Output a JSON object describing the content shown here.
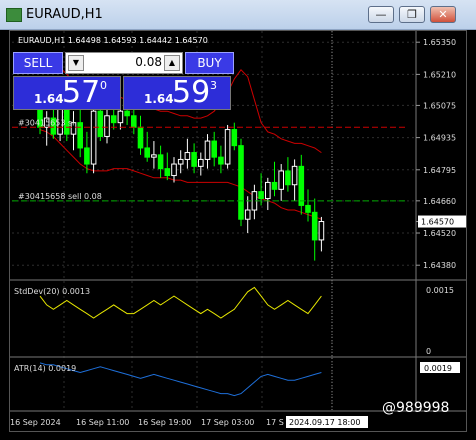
{
  "window": {
    "title": "EURAUD,H1",
    "minimize_glyph": "—",
    "restore_glyph": "❐",
    "close_glyph": "✕"
  },
  "chart_header": "EURAUD,H1  1.64498 1.64593 1.64442 1.64570",
  "trade_panel": {
    "sell_label": "SELL",
    "buy_label": "BUY",
    "lot": "0.08",
    "down_arrow": "▼",
    "up_arrow": "▲",
    "sell_price": {
      "prefix": "1.64",
      "big": "57",
      "sup": "0"
    },
    "buy_price": {
      "prefix": "1.64",
      "big": "59",
      "sup": "3"
    }
  },
  "orders": [
    {
      "label": "#30415653 sl"
    },
    {
      "label": "#30415658 sell 0.08"
    }
  ],
  "price_axis": [
    "1.65350",
    "1.65210",
    "1.65075",
    "1.64935",
    "1.64795",
    "1.64660",
    "1.64570",
    "1.64520",
    "1.64380"
  ],
  "current_price": "1.64570",
  "indicators": {
    "stddev": {
      "label": "StdDev(20) 0.0013",
      "axis_top": "0.0015",
      "axis_bottom": "0"
    },
    "atr": {
      "label": "ATR(14) 0.0019",
      "value": "0.0019"
    }
  },
  "time_axis": [
    "16 Sep 2024",
    "16 Sep 11:00",
    "16 Sep 19:00",
    "17 Sep 03:00",
    "17 S"
  ],
  "time_cursor": "2024.09.17 18:00",
  "watermark": "@989998",
  "colors": {
    "bull": "#ffffff",
    "bear": "#00ff00",
    "grid": "#2e2e2e",
    "band": "#cc0000",
    "stddev": "#e6e600",
    "atr": "#1e6fd9",
    "sl_line": "#cc0000",
    "order_line": "#00aa00"
  },
  "candles": [
    {
      "o": 1.6507,
      "h": 1.6512,
      "l": 1.6495,
      "c": 1.6498
    },
    {
      "o": 1.6498,
      "h": 1.6505,
      "l": 1.649,
      "c": 1.6502
    },
    {
      "o": 1.6502,
      "h": 1.651,
      "l": 1.6493,
      "c": 1.6495
    },
    {
      "o": 1.6495,
      "h": 1.6512,
      "l": 1.6492,
      "c": 1.6508
    },
    {
      "o": 1.6508,
      "h": 1.6511,
      "l": 1.6492,
      "c": 1.6495
    },
    {
      "o": 1.6495,
      "h": 1.6505,
      "l": 1.6488,
      "c": 1.65
    },
    {
      "o": 1.65,
      "h": 1.6506,
      "l": 1.6485,
      "c": 1.6489
    },
    {
      "o": 1.6489,
      "h": 1.6496,
      "l": 1.6478,
      "c": 1.6482
    },
    {
      "o": 1.6482,
      "h": 1.6508,
      "l": 1.6478,
      "c": 1.6505
    },
    {
      "o": 1.6505,
      "h": 1.6509,
      "l": 1.6492,
      "c": 1.6494
    },
    {
      "o": 1.6494,
      "h": 1.6506,
      "l": 1.6491,
      "c": 1.6503
    },
    {
      "o": 1.6503,
      "h": 1.6508,
      "l": 1.6497,
      "c": 1.65
    },
    {
      "o": 1.65,
      "h": 1.6507,
      "l": 1.6497,
      "c": 1.6505
    },
    {
      "o": 1.6505,
      "h": 1.6509,
      "l": 1.6499,
      "c": 1.6503
    },
    {
      "o": 1.6503,
      "h": 1.6508,
      "l": 1.6495,
      "c": 1.6498
    },
    {
      "o": 1.6498,
      "h": 1.6503,
      "l": 1.6486,
      "c": 1.6489
    },
    {
      "o": 1.6489,
      "h": 1.6496,
      "l": 1.6483,
      "c": 1.6485
    },
    {
      "o": 1.6485,
      "h": 1.6492,
      "l": 1.648,
      "c": 1.6486
    },
    {
      "o": 1.6486,
      "h": 1.649,
      "l": 1.6476,
      "c": 1.648
    },
    {
      "o": 1.648,
      "h": 1.6487,
      "l": 1.6475,
      "c": 1.6477
    },
    {
      "o": 1.6477,
      "h": 1.6485,
      "l": 1.6474,
      "c": 1.6482
    },
    {
      "o": 1.6482,
      "h": 1.6488,
      "l": 1.6478,
      "c": 1.6484
    },
    {
      "o": 1.6484,
      "h": 1.6493,
      "l": 1.648,
      "c": 1.6487
    },
    {
      "o": 1.6487,
      "h": 1.6491,
      "l": 1.6478,
      "c": 1.6481
    },
    {
      "o": 1.6481,
      "h": 1.6487,
      "l": 1.6477,
      "c": 1.6484
    },
    {
      "o": 1.6484,
      "h": 1.6495,
      "l": 1.648,
      "c": 1.6492
    },
    {
      "o": 1.6492,
      "h": 1.6496,
      "l": 1.6481,
      "c": 1.6485
    },
    {
      "o": 1.6485,
      "h": 1.649,
      "l": 1.6478,
      "c": 1.6482
    },
    {
      "o": 1.6482,
      "h": 1.6499,
      "l": 1.648,
      "c": 1.6497
    },
    {
      "o": 1.6497,
      "h": 1.65,
      "l": 1.6488,
      "c": 1.649
    },
    {
      "o": 1.649,
      "h": 1.6493,
      "l": 1.6455,
      "c": 1.6458
    },
    {
      "o": 1.6458,
      "h": 1.6468,
      "l": 1.6452,
      "c": 1.6462
    },
    {
      "o": 1.6462,
      "h": 1.6473,
      "l": 1.6458,
      "c": 1.647
    },
    {
      "o": 1.647,
      "h": 1.6478,
      "l": 1.6464,
      "c": 1.6467
    },
    {
      "o": 1.6467,
      "h": 1.6476,
      "l": 1.6462,
      "c": 1.6474
    },
    {
      "o": 1.6474,
      "h": 1.6483,
      "l": 1.6468,
      "c": 1.6471
    },
    {
      "o": 1.6471,
      "h": 1.6482,
      "l": 1.6466,
      "c": 1.6479
    },
    {
      "o": 1.6479,
      "h": 1.6485,
      "l": 1.647,
      "c": 1.6473
    },
    {
      "o": 1.6473,
      "h": 1.6484,
      "l": 1.6466,
      "c": 1.6481
    },
    {
      "o": 1.6481,
      "h": 1.6486,
      "l": 1.646,
      "c": 1.6464
    },
    {
      "o": 1.6464,
      "h": 1.6471,
      "l": 1.6457,
      "c": 1.6461
    },
    {
      "o": 1.6461,
      "h": 1.6467,
      "l": 1.644,
      "c": 1.6449
    },
    {
      "o": 1.6449,
      "h": 1.6459,
      "l": 1.6444,
      "c": 1.6457
    }
  ],
  "upper_band": [
    1.6528,
    1.6527,
    1.6526,
    1.6524,
    1.6521,
    1.6518,
    1.6517,
    1.6516,
    1.6515,
    1.6514,
    1.6513,
    1.6512,
    1.6511,
    1.651,
    1.6509,
    1.6508,
    1.6507,
    1.6506,
    1.6505,
    1.6505,
    1.6504,
    1.6503,
    1.6503,
    1.6502,
    1.6502,
    1.6503,
    1.6505,
    1.6509,
    1.6513,
    1.6519,
    1.6523,
    1.652,
    1.651,
    1.65,
    1.6496,
    1.6495,
    1.6493,
    1.6492,
    1.6491,
    1.6491,
    1.649,
    1.6489,
    1.6487
  ],
  "lower_band": [
    1.6497,
    1.6496,
    1.6494,
    1.6491,
    1.6488,
    1.6485,
    1.6482,
    1.648,
    1.6479,
    1.6479,
    1.6479,
    1.648,
    1.648,
    1.648,
    1.6479,
    1.6478,
    1.6477,
    1.6476,
    1.6476,
    1.6476,
    1.6475,
    1.6475,
    1.6474,
    1.6474,
    1.6474,
    1.6474,
    1.6474,
    1.6474,
    1.6474,
    1.6473,
    1.6472,
    1.647,
    1.6468,
    1.6467,
    1.6466,
    1.6465,
    1.6463,
    1.6462,
    1.6462,
    1.6461,
    1.646,
    1.6459,
    1.6458
  ],
  "stddev_values": [
    0.0013,
    0.0011,
    0.001,
    0.0011,
    0.0012,
    0.0011,
    0.001,
    0.0009,
    0.0008,
    0.0009,
    0.001,
    0.0011,
    0.001,
    0.0009,
    0.0009,
    0.001,
    0.0011,
    0.0012,
    0.0011,
    0.0012,
    0.0013,
    0.0012,
    0.0011,
    0.001,
    0.0009,
    0.001,
    0.0009,
    0.0008,
    0.0009,
    0.001,
    0.0012,
    0.0014,
    0.0015,
    0.0013,
    0.0011,
    0.001,
    0.0011,
    0.0012,
    0.0011,
    0.001,
    0.0009,
    0.0011,
    0.0013
  ],
  "atr_values": [
    0.0024,
    0.0023,
    0.0023,
    0.0022,
    0.0021,
    0.002,
    0.0019,
    0.002,
    0.0021,
    0.0022,
    0.0021,
    0.002,
    0.0019,
    0.0018,
    0.0017,
    0.0016,
    0.0017,
    0.0018,
    0.0017,
    0.0016,
    0.0015,
    0.0014,
    0.0013,
    0.0012,
    0.0011,
    0.001,
    0.0009,
    0.0008,
    0.0008,
    0.0007,
    0.0008,
    0.0011,
    0.0014,
    0.0017,
    0.0018,
    0.0017,
    0.0016,
    0.0015,
    0.0015,
    0.0016,
    0.0017,
    0.0018,
    0.0019
  ]
}
